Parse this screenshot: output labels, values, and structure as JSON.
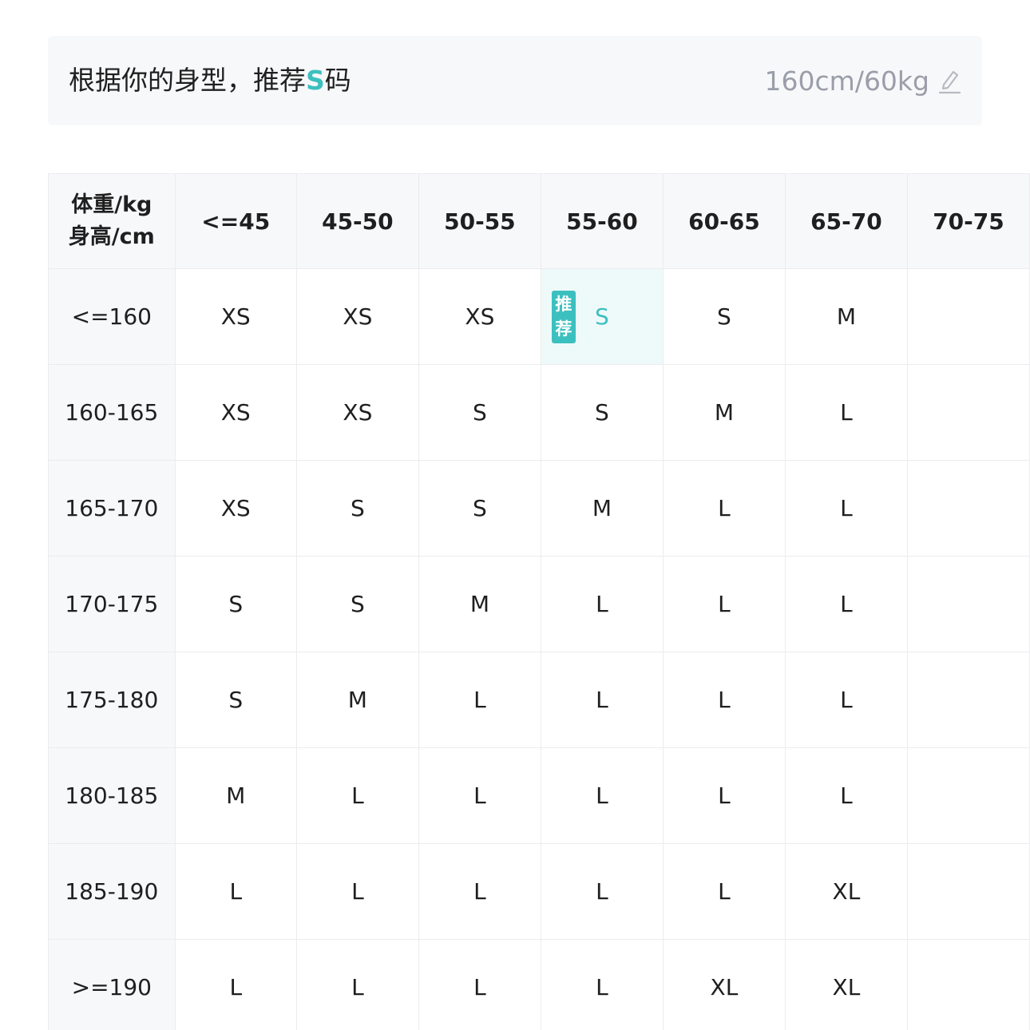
{
  "banner": {
    "prefix": "根据你的身型，推荐",
    "size": "S",
    "suffix": "码",
    "measurements": "160cm/60kg",
    "edit_icon": "edit-pencil-icon"
  },
  "size_table": {
    "corner_top": "体重/kg",
    "corner_bottom": "身高/cm",
    "weight_columns": [
      "<=45",
      "45-50",
      "50-55",
      "55-60",
      "60-65",
      "65-70",
      "70-75"
    ],
    "recommended_badge": "推荐",
    "recommended_badge_chars": [
      "推",
      "荐"
    ],
    "recommended_cell": {
      "row": 0,
      "col": 3
    },
    "rows": [
      {
        "height": "<=160",
        "sizes": [
          "XS",
          "XS",
          "XS",
          "S",
          "S",
          "M",
          ""
        ]
      },
      {
        "height": "160-165",
        "sizes": [
          "XS",
          "XS",
          "S",
          "S",
          "M",
          "L",
          ""
        ]
      },
      {
        "height": "165-170",
        "sizes": [
          "XS",
          "S",
          "S",
          "M",
          "L",
          "L",
          ""
        ]
      },
      {
        "height": "170-175",
        "sizes": [
          "S",
          "S",
          "M",
          "L",
          "L",
          "L",
          ""
        ]
      },
      {
        "height": "175-180",
        "sizes": [
          "S",
          "M",
          "L",
          "L",
          "L",
          "L",
          ""
        ]
      },
      {
        "height": "180-185",
        "sizes": [
          "M",
          "L",
          "L",
          "L",
          "L",
          "L",
          ""
        ]
      },
      {
        "height": "185-190",
        "sizes": [
          "L",
          "L",
          "L",
          "L",
          "L",
          "XL",
          ""
        ]
      },
      {
        "height": ">=190",
        "sizes": [
          "L",
          "L",
          "L",
          "L",
          "XL",
          "XL",
          ""
        ]
      }
    ]
  },
  "colors": {
    "accent": "#3cc0bf",
    "recommended_bg": "#eefaf9",
    "header_bg": "#f7f8fa",
    "border": "#ececef",
    "muted_text": "#9a9ea8"
  }
}
